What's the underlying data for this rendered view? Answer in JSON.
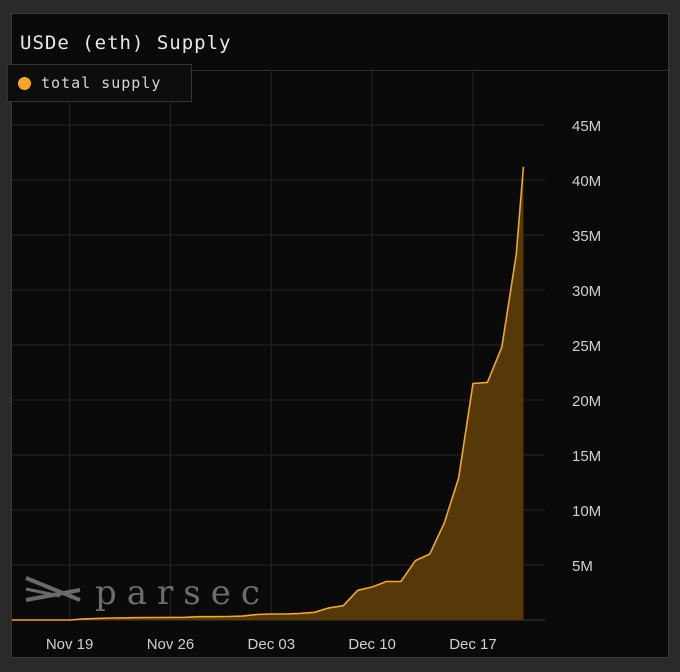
{
  "panel": {
    "title": "USDe (eth) Supply"
  },
  "watermark": {
    "text": "parsec"
  },
  "colors": {
    "accent": "#f5a623",
    "area": "#5a3c0a",
    "grid": "#262626",
    "axis_text": "#d0d0d0"
  },
  "chart_data": {
    "type": "area",
    "title": "USDe (eth) Supply",
    "xlabel": "",
    "ylabel": "",
    "grid": true,
    "legend_position": "top-left",
    "x_axis": {
      "type": "date",
      "min": "2023-11-15",
      "max": "2023-12-22",
      "tick_dates": [
        "2023-11-19",
        "2023-11-26",
        "2023-12-03",
        "2023-12-10",
        "2023-12-17"
      ],
      "tick_labels": [
        "Nov 19",
        "Nov 26",
        "Dec 03",
        "Dec 10",
        "Dec 17"
      ]
    },
    "y_axis": {
      "min": 0,
      "max": 50000000,
      "ticks": [
        5000000,
        10000000,
        15000000,
        20000000,
        25000000,
        30000000,
        35000000,
        40000000,
        45000000
      ],
      "tick_labels": [
        "5M",
        "10M",
        "15M",
        "20M",
        "25M",
        "30M",
        "35M",
        "40M",
        "45M"
      ],
      "position": "right"
    },
    "series": [
      {
        "name": "total supply",
        "points": [
          {
            "x": "2023-11-15",
            "y": 0
          },
          {
            "x": "2023-11-16",
            "y": 0
          },
          {
            "x": "2023-11-17",
            "y": 0
          },
          {
            "x": "2023-11-18",
            "y": 0
          },
          {
            "x": "2023-11-19",
            "y": 0
          },
          {
            "x": "2023-11-20",
            "y": 100000
          },
          {
            "x": "2023-11-21",
            "y": 150000
          },
          {
            "x": "2023-11-22",
            "y": 180000
          },
          {
            "x": "2023-11-23",
            "y": 200000
          },
          {
            "x": "2023-11-24",
            "y": 220000
          },
          {
            "x": "2023-11-25",
            "y": 230000
          },
          {
            "x": "2023-11-26",
            "y": 240000
          },
          {
            "x": "2023-11-27",
            "y": 250000
          },
          {
            "x": "2023-11-28",
            "y": 300000
          },
          {
            "x": "2023-11-29",
            "y": 300000
          },
          {
            "x": "2023-11-30",
            "y": 320000
          },
          {
            "x": "2023-12-01",
            "y": 350000
          },
          {
            "x": "2023-12-02",
            "y": 500000
          },
          {
            "x": "2023-12-03",
            "y": 550000
          },
          {
            "x": "2023-12-04",
            "y": 550000
          },
          {
            "x": "2023-12-05",
            "y": 600000
          },
          {
            "x": "2023-12-06",
            "y": 700000
          },
          {
            "x": "2023-12-07",
            "y": 1100000
          },
          {
            "x": "2023-12-08",
            "y": 1300000
          },
          {
            "x": "2023-12-09",
            "y": 2700000
          },
          {
            "x": "2023-12-10",
            "y": 3000000
          },
          {
            "x": "2023-12-11",
            "y": 3500000
          },
          {
            "x": "2023-12-12",
            "y": 3500000
          },
          {
            "x": "2023-12-13",
            "y": 5400000
          },
          {
            "x": "2023-12-14",
            "y": 6000000
          },
          {
            "x": "2023-12-15",
            "y": 8800000
          },
          {
            "x": "2023-12-16",
            "y": 12900000
          },
          {
            "x": "2023-12-17",
            "y": 21500000
          },
          {
            "x": "2023-12-18",
            "y": 21600000
          },
          {
            "x": "2023-12-19",
            "y": 24800000
          },
          {
            "x": "2023-12-20",
            "y": 33200000
          },
          {
            "x": "2023-12-20T12:00",
            "y": 41200000
          }
        ]
      }
    ]
  }
}
